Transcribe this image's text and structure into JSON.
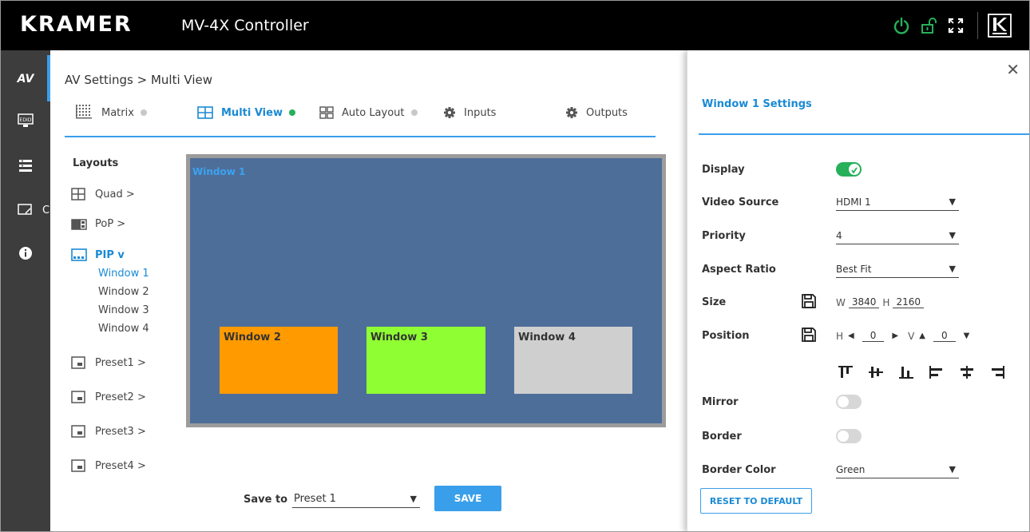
{
  "header": {
    "logo": "KRAMER",
    "title": "MV-4X Controller",
    "icons": [
      "power-icon",
      "unlock-icon",
      "fullscreen-icon",
      "kramer-k-icon"
    ],
    "power_color": "#26b05a"
  },
  "rail": {
    "items": [
      {
        "label": "AV",
        "icon": "av-icon",
        "active": true
      },
      {
        "label": "EDID",
        "icon": "edid-icon"
      },
      {
        "label": "",
        "icon": "device-settings-icon"
      },
      {
        "label": "C",
        "icon": "screen-icon"
      },
      {
        "label": "",
        "icon": "info-icon"
      }
    ]
  },
  "breadcrumb": "AV Settings > Multi View",
  "tabs": [
    {
      "label": "Matrix",
      "icon": "matrix-icon"
    },
    {
      "label": "Multi View",
      "icon": "multiview-icon",
      "active": true
    },
    {
      "label": "Auto Layout",
      "icon": "auto-layout-icon"
    },
    {
      "label": "Inputs",
      "icon": "gear-icon"
    },
    {
      "label": "Outputs",
      "icon": "gear-icon"
    }
  ],
  "layouts": {
    "title": "Layouts",
    "items": [
      {
        "label": "Quad >",
        "icon": "quad-icon"
      },
      {
        "label": "PoP >",
        "icon": "pop-icon"
      },
      {
        "label": "PIP v",
        "icon": "pip-icon",
        "active": true
      },
      {
        "label": "Preset1 >",
        "icon": "preset-icon"
      },
      {
        "label": "Preset2 >",
        "icon": "preset-icon"
      },
      {
        "label": "Preset3 >",
        "icon": "preset-icon"
      },
      {
        "label": "Preset4 >",
        "icon": "preset-icon"
      }
    ],
    "pip_windows": [
      "Window 1",
      "Window 2",
      "Window 3",
      "Window 4"
    ]
  },
  "canvas": {
    "main_window": "Window 1",
    "main_color": "#4e6e9a",
    "windows": [
      {
        "label": "Window 2",
        "color": "#ff9a00"
      },
      {
        "label": "Window 3",
        "color": "#8fff33"
      },
      {
        "label": "Window 4",
        "color": "#cfcfcf"
      }
    ]
  },
  "save": {
    "label": "Save to",
    "value": "Preset 1",
    "button": "SAVE"
  },
  "panel": {
    "title": "Window 1 Settings",
    "display_label": "Display",
    "display_on": true,
    "video_source_label": "Video Source",
    "video_source": "HDMI 1",
    "priority_label": "Priority",
    "priority": "4",
    "aspect_label": "Aspect Ratio",
    "aspect": "Best Fit",
    "size_label": "Size",
    "size_w_prefix": "W",
    "size_w": "3840",
    "size_h_prefix": "H",
    "size_h": "2160",
    "position_label": "Position",
    "pos_h_prefix": "H",
    "pos_h": "0",
    "pos_v_prefix": "V",
    "pos_v": "0",
    "mirror_label": "Mirror",
    "mirror_on": false,
    "border_label": "Border",
    "border_on": false,
    "border_color_label": "Border Color",
    "border_color": "Green",
    "reset_button": "RESET TO DEFAULT"
  }
}
